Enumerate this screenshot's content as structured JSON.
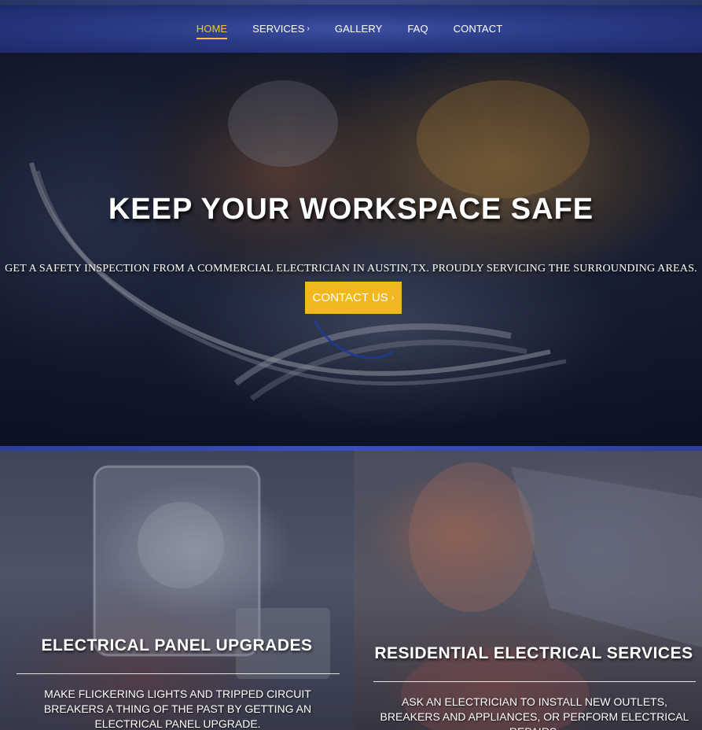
{
  "nav": {
    "items": [
      {
        "label": "HOME"
      },
      {
        "label": "SERVICES"
      },
      {
        "label": "GALLERY"
      },
      {
        "label": "FAQ"
      },
      {
        "label": "CONTACT"
      }
    ],
    "active": "HOME",
    "services_caret": "›"
  },
  "hero": {
    "title": "KEEP YOUR WORKSPACE SAFE",
    "subtitle": "GET A SAFETY INSPECTION FROM A COMMERCIAL ELECTRICIAN IN AUSTIN,TX. PROUDLY SERVICING THE SURROUNDING AREAS.",
    "cta_label": "CONTACT US",
    "cta_caret": "›"
  },
  "cards": [
    {
      "title": "ELECTRICAL PANEL UPGRADES",
      "text": "MAKE FLICKERING LIGHTS AND TRIPPED CIRCUIT BREAKERS A THING OF THE PAST BY GETTING AN ELECTRICAL PANEL UPGRADE."
    },
    {
      "title": "RESIDENTIAL ELECTRICAL SERVICES",
      "text": "ASK AN ELECTRICIAN TO INSTALL NEW OUTLETS, BREAKERS AND APPLIANCES, OR PERFORM ELECTRICAL REPAIRS."
    }
  ],
  "colors": {
    "accent": "#f0b81e",
    "nav_bg": "#2a3a86",
    "divider": "#3a50c0"
  },
  "icons": {
    "caret": "chevron-right-icon"
  }
}
